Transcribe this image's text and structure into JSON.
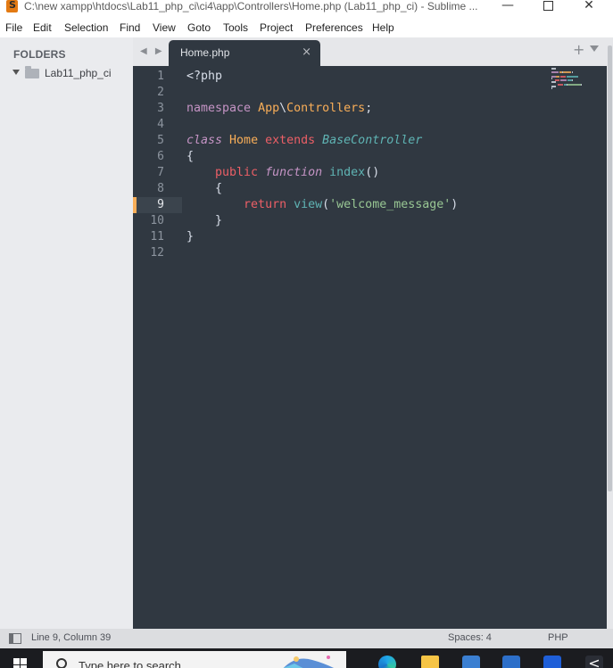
{
  "window": {
    "title": "C:\\new xampp\\htdocs\\Lab11_php_ci\\ci4\\app\\Controllers\\Home.php (Lab11_php_ci) - Sublime ...",
    "controls": [
      "minimize",
      "maximize",
      "close"
    ]
  },
  "menu": {
    "items": [
      "File",
      "Edit",
      "Selection",
      "Find",
      "View",
      "Goto",
      "Tools",
      "Project",
      "Preferences",
      "Help"
    ]
  },
  "sidebar": {
    "title": "FOLDERS",
    "folders": [
      {
        "label": "Lab11_php_ci",
        "expanded": true
      }
    ]
  },
  "tabs": [
    {
      "label": "Home.php",
      "active": true,
      "close": "×"
    }
  ],
  "tabbar": {
    "nav": "◀ ▶",
    "plus": "+"
  },
  "editor": {
    "line_numbers": [
      "1",
      "2",
      "3",
      "4",
      "5",
      "6",
      "7",
      "8",
      "9",
      "10",
      "11",
      "12"
    ],
    "current_line": 9,
    "syntax_colors": {
      "background": "#303841",
      "keyword": "#ec5f66",
      "class_name": "#f9ae58",
      "storage": "#c594c5",
      "function": "#5fb4b4",
      "string": "#99c794",
      "plain": "#d8dee9"
    },
    "code": [
      [
        {
          "t": "<?php",
          "c": "plain"
        }
      ],
      [],
      [
        {
          "t": "namespace",
          "c": "ns"
        },
        {
          "t": " ",
          "c": "plain"
        },
        {
          "t": "App",
          "c": "class"
        },
        {
          "t": "\\",
          "c": "plain"
        },
        {
          "t": "Controllers",
          "c": "class"
        },
        {
          "t": ";",
          "c": "plain"
        }
      ],
      [],
      [
        {
          "t": "class",
          "c": "ital"
        },
        {
          "t": " ",
          "c": "plain"
        },
        {
          "t": "Home",
          "c": "class"
        },
        {
          "t": " ",
          "c": "plain"
        },
        {
          "t": "extends",
          "c": "key"
        },
        {
          "t": " ",
          "c": "plain"
        },
        {
          "t": "BaseController",
          "c": "base"
        }
      ],
      [
        {
          "t": "{",
          "c": "plain"
        }
      ],
      [
        {
          "t": "    ",
          "c": "plain"
        },
        {
          "t": "public",
          "c": "key"
        },
        {
          "t": " ",
          "c": "plain"
        },
        {
          "t": "function",
          "c": "ital"
        },
        {
          "t": " ",
          "c": "plain"
        },
        {
          "t": "index",
          "c": "fn"
        },
        {
          "t": "()",
          "c": "plain"
        }
      ],
      [
        {
          "t": "    {",
          "c": "plain"
        }
      ],
      [
        {
          "t": "        ",
          "c": "plain"
        },
        {
          "t": "return",
          "c": "ret"
        },
        {
          "t": " ",
          "c": "plain"
        },
        {
          "t": "view",
          "c": "fn"
        },
        {
          "t": "(",
          "c": "plain"
        },
        {
          "t": "'welcome_message'",
          "c": "str"
        },
        {
          "t": ")",
          "c": "plain"
        }
      ],
      [
        {
          "t": "    }",
          "c": "plain"
        }
      ],
      [
        {
          "t": "}",
          "c": "plain"
        }
      ],
      []
    ]
  },
  "statusbar": {
    "position": "Line 9, Column 39",
    "indent": "Spaces: 4",
    "syntax": "PHP"
  },
  "taskbar": {
    "search_placeholder": "Type here to search",
    "icons": [
      "windows-start-icon",
      "edge-icon",
      "file-explorer-icon",
      "store-icon",
      "mail-icon",
      "dropbox-icon",
      "visual-studio-icon"
    ]
  }
}
